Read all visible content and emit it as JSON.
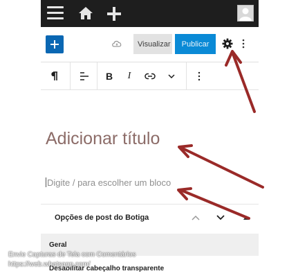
{
  "editor": {
    "preview_label": "Visualizar",
    "publish_label": "Publicar",
    "title_placeholder": "Adicionar título",
    "paragraph_placeholder": "Digite / para escolher um bloco"
  },
  "block_toolbar": {
    "bold": "B",
    "italic": "I"
  },
  "panel": {
    "title": "Opções de post do Botiga",
    "section": "Geral",
    "setting_label": "Desabilitar cabeçalho transparente"
  },
  "overlay": {
    "line1": "Envie Capturas de Tela com Comentários",
    "line2": "https://web.whatsapp.com/"
  },
  "colors": {
    "admin_bar": "#1e1e1e",
    "primary": "#0a67b3",
    "publish": "#0a8ad6",
    "title": "#8c6c68",
    "arrow": "#9a2a28"
  },
  "icons": [
    "menu-icon",
    "home-icon",
    "plus-icon",
    "avatar-icon",
    "inserter-icon",
    "cloud-icon",
    "settings-gear-icon",
    "more-vertical-icon",
    "paragraph-icon",
    "align-icon",
    "bold-icon",
    "italic-icon",
    "link-icon",
    "chevron-down-icon",
    "chevron-up-icon",
    "triangle-up-icon"
  ]
}
